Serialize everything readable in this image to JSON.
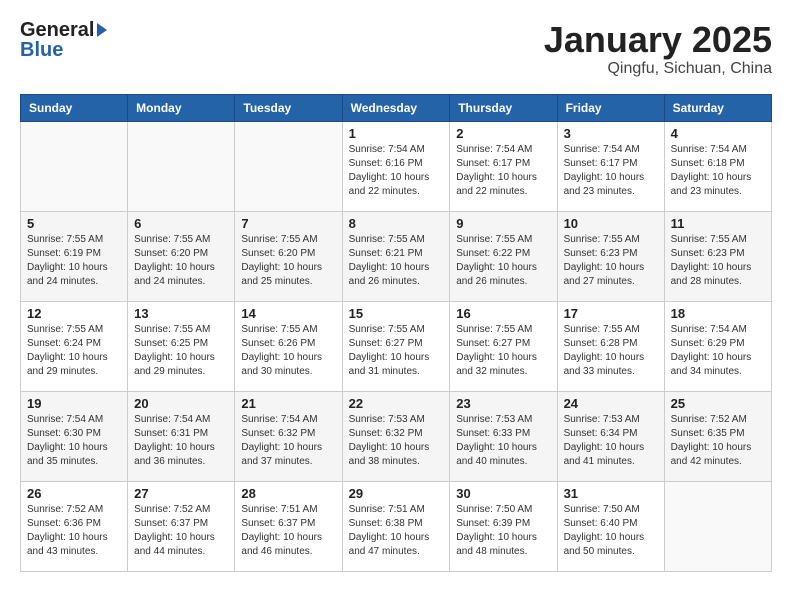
{
  "header": {
    "logo_general": "General",
    "logo_blue": "Blue",
    "month": "January 2025",
    "location": "Qingfu, Sichuan, China"
  },
  "days_of_week": [
    "Sunday",
    "Monday",
    "Tuesday",
    "Wednesday",
    "Thursday",
    "Friday",
    "Saturday"
  ],
  "weeks": [
    [
      {
        "day": "",
        "info": ""
      },
      {
        "day": "",
        "info": ""
      },
      {
        "day": "",
        "info": ""
      },
      {
        "day": "1",
        "info": "Sunrise: 7:54 AM\nSunset: 6:16 PM\nDaylight: 10 hours\nand 22 minutes."
      },
      {
        "day": "2",
        "info": "Sunrise: 7:54 AM\nSunset: 6:17 PM\nDaylight: 10 hours\nand 22 minutes."
      },
      {
        "day": "3",
        "info": "Sunrise: 7:54 AM\nSunset: 6:17 PM\nDaylight: 10 hours\nand 23 minutes."
      },
      {
        "day": "4",
        "info": "Sunrise: 7:54 AM\nSunset: 6:18 PM\nDaylight: 10 hours\nand 23 minutes."
      }
    ],
    [
      {
        "day": "5",
        "info": "Sunrise: 7:55 AM\nSunset: 6:19 PM\nDaylight: 10 hours\nand 24 minutes."
      },
      {
        "day": "6",
        "info": "Sunrise: 7:55 AM\nSunset: 6:20 PM\nDaylight: 10 hours\nand 24 minutes."
      },
      {
        "day": "7",
        "info": "Sunrise: 7:55 AM\nSunset: 6:20 PM\nDaylight: 10 hours\nand 25 minutes."
      },
      {
        "day": "8",
        "info": "Sunrise: 7:55 AM\nSunset: 6:21 PM\nDaylight: 10 hours\nand 26 minutes."
      },
      {
        "day": "9",
        "info": "Sunrise: 7:55 AM\nSunset: 6:22 PM\nDaylight: 10 hours\nand 26 minutes."
      },
      {
        "day": "10",
        "info": "Sunrise: 7:55 AM\nSunset: 6:23 PM\nDaylight: 10 hours\nand 27 minutes."
      },
      {
        "day": "11",
        "info": "Sunrise: 7:55 AM\nSunset: 6:23 PM\nDaylight: 10 hours\nand 28 minutes."
      }
    ],
    [
      {
        "day": "12",
        "info": "Sunrise: 7:55 AM\nSunset: 6:24 PM\nDaylight: 10 hours\nand 29 minutes."
      },
      {
        "day": "13",
        "info": "Sunrise: 7:55 AM\nSunset: 6:25 PM\nDaylight: 10 hours\nand 29 minutes."
      },
      {
        "day": "14",
        "info": "Sunrise: 7:55 AM\nSunset: 6:26 PM\nDaylight: 10 hours\nand 30 minutes."
      },
      {
        "day": "15",
        "info": "Sunrise: 7:55 AM\nSunset: 6:27 PM\nDaylight: 10 hours\nand 31 minutes."
      },
      {
        "day": "16",
        "info": "Sunrise: 7:55 AM\nSunset: 6:27 PM\nDaylight: 10 hours\nand 32 minutes."
      },
      {
        "day": "17",
        "info": "Sunrise: 7:55 AM\nSunset: 6:28 PM\nDaylight: 10 hours\nand 33 minutes."
      },
      {
        "day": "18",
        "info": "Sunrise: 7:54 AM\nSunset: 6:29 PM\nDaylight: 10 hours\nand 34 minutes."
      }
    ],
    [
      {
        "day": "19",
        "info": "Sunrise: 7:54 AM\nSunset: 6:30 PM\nDaylight: 10 hours\nand 35 minutes."
      },
      {
        "day": "20",
        "info": "Sunrise: 7:54 AM\nSunset: 6:31 PM\nDaylight: 10 hours\nand 36 minutes."
      },
      {
        "day": "21",
        "info": "Sunrise: 7:54 AM\nSunset: 6:32 PM\nDaylight: 10 hours\nand 37 minutes."
      },
      {
        "day": "22",
        "info": "Sunrise: 7:53 AM\nSunset: 6:32 PM\nDaylight: 10 hours\nand 38 minutes."
      },
      {
        "day": "23",
        "info": "Sunrise: 7:53 AM\nSunset: 6:33 PM\nDaylight: 10 hours\nand 40 minutes."
      },
      {
        "day": "24",
        "info": "Sunrise: 7:53 AM\nSunset: 6:34 PM\nDaylight: 10 hours\nand 41 minutes."
      },
      {
        "day": "25",
        "info": "Sunrise: 7:52 AM\nSunset: 6:35 PM\nDaylight: 10 hours\nand 42 minutes."
      }
    ],
    [
      {
        "day": "26",
        "info": "Sunrise: 7:52 AM\nSunset: 6:36 PM\nDaylight: 10 hours\nand 43 minutes."
      },
      {
        "day": "27",
        "info": "Sunrise: 7:52 AM\nSunset: 6:37 PM\nDaylight: 10 hours\nand 44 minutes."
      },
      {
        "day": "28",
        "info": "Sunrise: 7:51 AM\nSunset: 6:37 PM\nDaylight: 10 hours\nand 46 minutes."
      },
      {
        "day": "29",
        "info": "Sunrise: 7:51 AM\nSunset: 6:38 PM\nDaylight: 10 hours\nand 47 minutes."
      },
      {
        "day": "30",
        "info": "Sunrise: 7:50 AM\nSunset: 6:39 PM\nDaylight: 10 hours\nand 48 minutes."
      },
      {
        "day": "31",
        "info": "Sunrise: 7:50 AM\nSunset: 6:40 PM\nDaylight: 10 hours\nand 50 minutes."
      },
      {
        "day": "",
        "info": ""
      }
    ]
  ]
}
